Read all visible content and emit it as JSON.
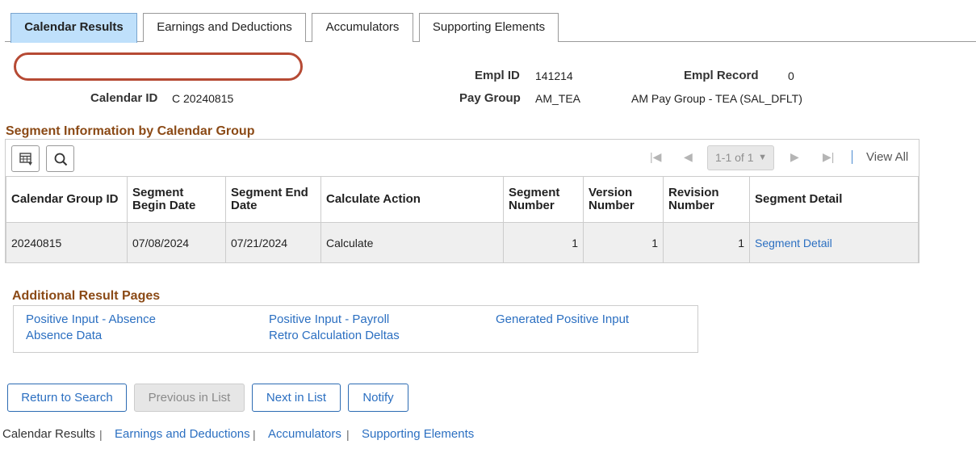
{
  "tabs": [
    {
      "label": "Calendar Results",
      "active": true
    },
    {
      "label": "Earnings and Deductions",
      "active": false
    },
    {
      "label": "Accumulators",
      "active": false
    },
    {
      "label": "Supporting Elements",
      "active": false
    }
  ],
  "header": {
    "empl_id_label": "Empl ID",
    "empl_id_value": "141214",
    "empl_record_label": "Empl Record",
    "empl_record_value": "0",
    "calendar_id_label": "Calendar ID",
    "calendar_id_value": "C 20240815",
    "pay_group_label": "Pay Group",
    "pay_group_value": "AM_TEA",
    "pay_group_desc": "AM Pay Group - TEA (SAL_DFLT)"
  },
  "segment_section": {
    "title": "Segment Information by Calendar Group",
    "pager_text": "1-1 of 1",
    "view_all": "View All",
    "columns": [
      "Calendar Group ID",
      "Segment Begin Date",
      "Segment End Date",
      "Calculate Action",
      "Segment Number",
      "Version Number",
      "Revision Number",
      "Segment Detail"
    ],
    "rows": [
      {
        "calendar_group_id": "20240815",
        "begin_date": "07/08/2024",
        "end_date": "07/21/2024",
        "calculate_action": "Calculate",
        "segment_number": "1",
        "version_number": "1",
        "revision_number": "1",
        "segment_detail": "Segment Detail"
      }
    ]
  },
  "additional": {
    "title": "Additional Result Pages",
    "links": [
      "Positive Input - Absence",
      "Positive Input - Payroll",
      "Generated Positive Input",
      "Absence Data",
      "Retro Calculation Deltas"
    ]
  },
  "buttons": {
    "return": "Return to Search",
    "previous": "Previous in List",
    "next": "Next in List",
    "notify": "Notify"
  },
  "footer": {
    "current": "Calendar Results",
    "links": [
      "Earnings and Deductions",
      "Accumulators",
      "Supporting Elements"
    ]
  },
  "colors": {
    "active_tab": "#bfe0fb",
    "section_title": "#8b4a16",
    "link": "#2b6fc1",
    "redaction_outline": "#b64a34"
  }
}
